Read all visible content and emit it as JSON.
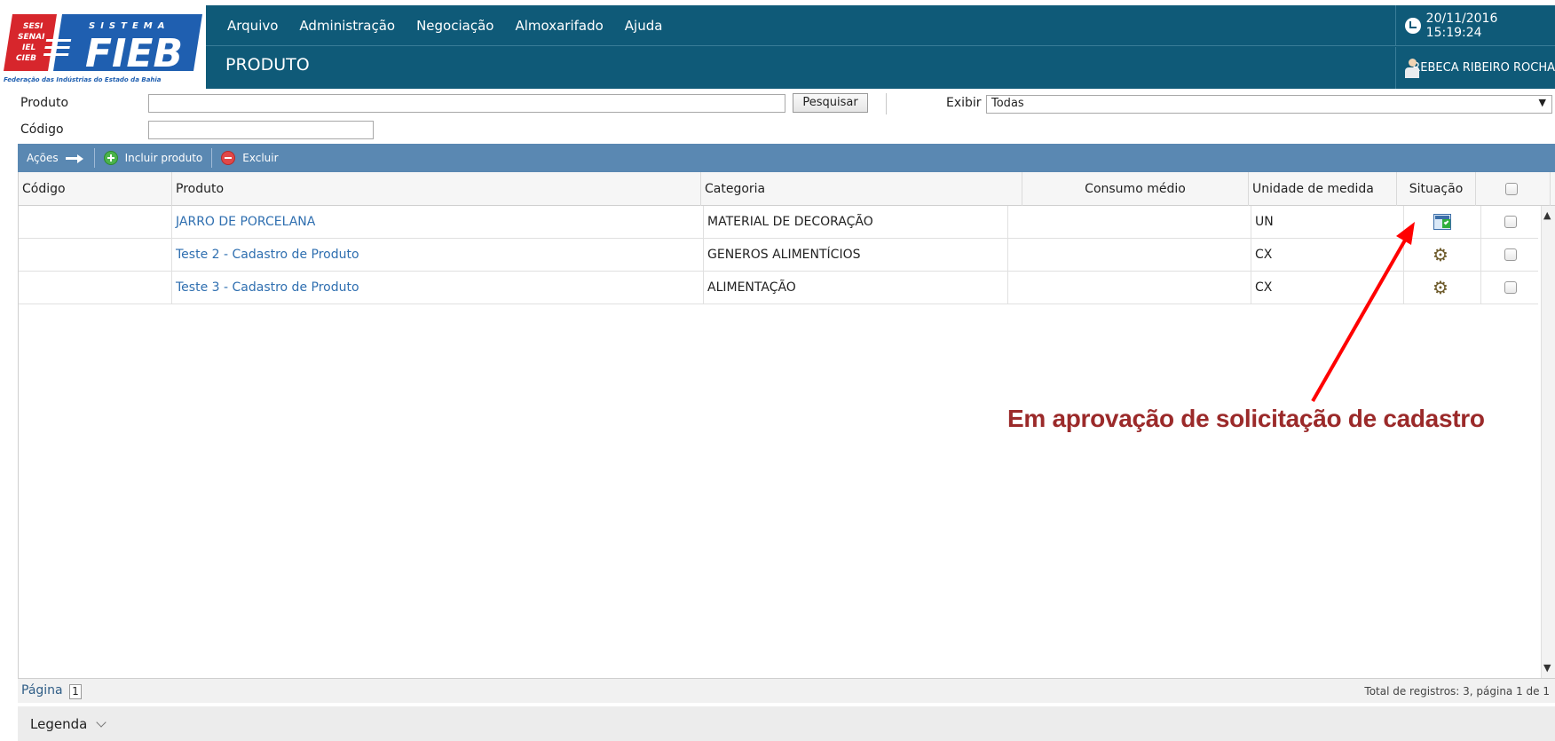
{
  "brand": {
    "logo_sesi": "SESI",
    "logo_senai": "SENAI",
    "logo_iel": "IEL",
    "logo_cieb": "CIEB",
    "logo_sistema": "SISTEMA",
    "logo_fieb": "FIEB",
    "logo_tagline": "Federação das Indústrias do Estado da Bahia",
    "primary_color": "#0f5a78",
    "logo_red": "#d7262c",
    "logo_blue": "#1f5fb0"
  },
  "menu": {
    "items": [
      "Arquivo",
      "Administração",
      "Negociação",
      "Almoxarifado",
      "Ajuda"
    ]
  },
  "page_title": "PRODUTO",
  "clock": {
    "datetime": "20/11/2016 15:19:24",
    "icon": "clock-icon"
  },
  "user": {
    "name": "REBECA RIBEIRO ROCHA",
    "icon": "user-icon"
  },
  "filters": {
    "produto_label": "Produto",
    "produto_value": "",
    "codigo_label": "Código",
    "codigo_value": "",
    "search_button": "Pesquisar",
    "exibir_label": "Exibir",
    "exibir_value": "Todas"
  },
  "toolbar": {
    "acoes": "Ações",
    "incluir": "Incluir produto",
    "excluir": "Excluir"
  },
  "grid": {
    "columns": [
      "Código",
      "Produto",
      "Categoria",
      "Consumo médio",
      "Unidade de medida",
      "Situação"
    ],
    "rows": [
      {
        "codigo": "",
        "produto": "JARRO DE PORCELANA",
        "categoria": "MATERIAL DE DECORAÇÃO",
        "consumo": "",
        "unidade": "UN",
        "situacao": "approval-icon"
      },
      {
        "codigo": "",
        "produto": "Teste 2 - Cadastro de Produto",
        "categoria": "GENEROS ALIMENTÍCIOS",
        "consumo": "",
        "unidade": "CX",
        "situacao": "gears-icon"
      },
      {
        "codigo": "",
        "produto": "Teste 3 - Cadastro de Produto",
        "categoria": "ALIMENTAÇÃO",
        "consumo": "",
        "unidade": "CX",
        "situacao": "gears-icon"
      }
    ]
  },
  "pager": {
    "label": "Página",
    "page": "1",
    "total": "Total de registros: 3, página 1 de 1"
  },
  "legend": {
    "label": "Legenda"
  },
  "annotation": {
    "text": "Em aprovação de solicitação de cadastro",
    "color": "#9b2a2a",
    "arrow_color": "#ff0000"
  }
}
